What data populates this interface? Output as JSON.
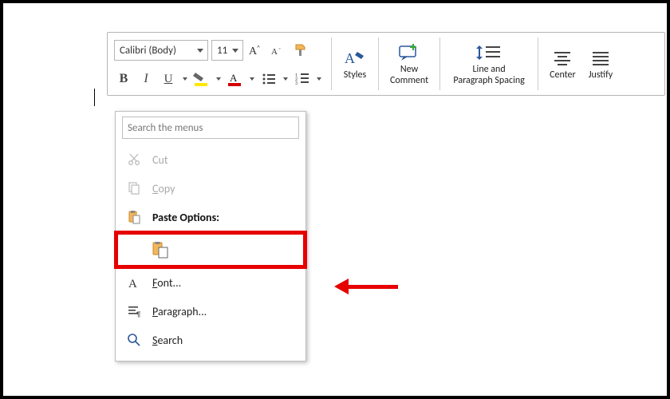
{
  "toolbar": {
    "font_name": "Calibri (Body)",
    "font_size": "11",
    "styles": "Styles",
    "new_comment_1": "New",
    "new_comment_2": "Comment",
    "line_spacing_1": "Line and",
    "line_spacing_2": "Paragraph Spacing",
    "center": "Center",
    "justify": "Justify"
  },
  "menu": {
    "search_placeholder": "Search the menus",
    "cut": "Cut",
    "copy_u": "C",
    "copy_rest": "opy",
    "paste_options": "Paste Options:",
    "font_u": "F",
    "font_rest": "ont...",
    "paragraph_u": "P",
    "paragraph_rest": "aragraph...",
    "search_u": "S",
    "search_rest": "earch"
  },
  "annotations": {
    "highlight_color": "#e60000",
    "arrow_points_to": "paste-options-row"
  }
}
